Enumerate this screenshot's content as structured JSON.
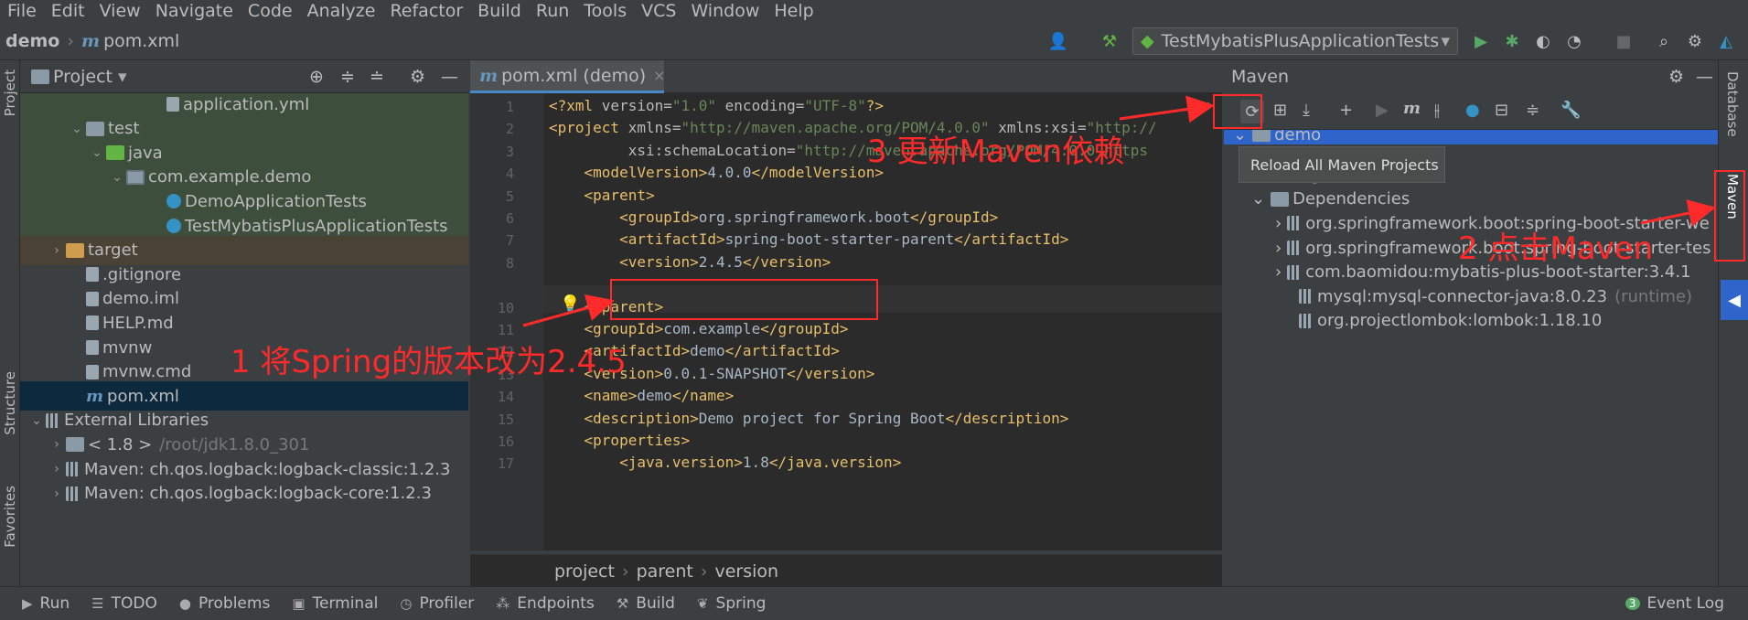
{
  "menu": [
    "File",
    "Edit",
    "View",
    "Navigate",
    "Code",
    "Analyze",
    "Refactor",
    "Build",
    "Run",
    "Tools",
    "VCS",
    "Window",
    "Help"
  ],
  "breadcrumb": {
    "project": "demo",
    "file": "pom.xml"
  },
  "run_config": "TestMybatisPlusApplicationTests",
  "left_strip": {
    "project": "Project",
    "structure": "Structure",
    "favorites": "Favorites"
  },
  "project_panel": {
    "title": "Project",
    "rows": [
      {
        "label": "application.yml",
        "indent": 140,
        "icon": "file",
        "arrow": ""
      },
      {
        "label": "test",
        "indent": 52,
        "icon": "folder",
        "arrow": "⌄"
      },
      {
        "label": "java",
        "indent": 74,
        "icon": "folderg",
        "arrow": "⌄"
      },
      {
        "label": "com.example.demo",
        "indent": 96,
        "icon": "pkg",
        "arrow": "⌄"
      },
      {
        "label": "DemoApplicationTests",
        "indent": 140,
        "icon": "cls",
        "arrow": ""
      },
      {
        "label": "TestMybatisPlusApplicationTests",
        "indent": 140,
        "icon": "cls",
        "arrow": ""
      },
      {
        "label": "target",
        "indent": 30,
        "icon": "foldero",
        "arrow": "›"
      },
      {
        "label": ".gitignore",
        "indent": 52,
        "icon": "file",
        "arrow": ""
      },
      {
        "label": "demo.iml",
        "indent": 52,
        "icon": "file",
        "arrow": ""
      },
      {
        "label": "HELP.md",
        "indent": 52,
        "icon": "file",
        "arrow": ""
      },
      {
        "label": "mvnw",
        "indent": 52,
        "icon": "file",
        "arrow": ""
      },
      {
        "label": "mvnw.cmd",
        "indent": 52,
        "icon": "file",
        "arrow": ""
      },
      {
        "label": "pom.xml",
        "indent": 52,
        "icon": "m",
        "arrow": ""
      },
      {
        "label": "External Libraries",
        "indent": 8,
        "icon": "lib",
        "arrow": "⌄"
      },
      {
        "label": "< 1.8 >",
        "extra": "/root/jdk1.8.0_301",
        "indent": 30,
        "icon": "folder",
        "arrow": "›"
      },
      {
        "label": "Maven: ch.qos.logback:logback-classic:1.2.3",
        "indent": 30,
        "icon": "lib",
        "arrow": "›"
      },
      {
        "label": "Maven: ch.qos.logback:logback-core:1.2.3",
        "indent": 30,
        "icon": "lib",
        "arrow": "›"
      }
    ]
  },
  "editor": {
    "tab": "pom.xml (demo)",
    "lines": [
      {
        "n": "1",
        "parts": [
          [
            "tg",
            "<?xml "
          ],
          [
            "at",
            "version="
          ],
          [
            "av",
            "\"1.0\""
          ],
          [
            "at",
            " encoding="
          ],
          [
            "av",
            "\"UTF-8\""
          ],
          [
            "tg",
            "?>"
          ]
        ]
      },
      {
        "n": "2",
        "parts": [
          [
            "tg",
            "<project "
          ],
          [
            "at",
            "xmlns="
          ],
          [
            "av",
            "\"http://maven.apache.org/POM/4.0.0\""
          ],
          [
            "at",
            " xmlns:xsi="
          ],
          [
            "av",
            "\"http://"
          ]
        ]
      },
      {
        "n": "3",
        "parts": [
          [
            "at",
            "         xsi:schemaLocation="
          ],
          [
            "av",
            "\"http://maven.apache.org/POM/4.0.0 https"
          ]
        ]
      },
      {
        "n": "4",
        "parts": [
          [
            "tg",
            "    <modelVersion>"
          ],
          [
            "tx",
            "4.0.0"
          ],
          [
            "tg",
            "</modelVersion>"
          ]
        ]
      },
      {
        "n": "5",
        "parts": [
          [
            "tg",
            "    <parent>"
          ]
        ]
      },
      {
        "n": "6",
        "parts": [
          [
            "tg",
            "        <groupId>"
          ],
          [
            "tx",
            "org.springframework.boot"
          ],
          [
            "tg",
            "</groupId>"
          ]
        ]
      },
      {
        "n": "7",
        "parts": [
          [
            "tg",
            "        <artifactId>"
          ],
          [
            "tx",
            "spring-boot-starter-parent"
          ],
          [
            "tg",
            "</artifactId>"
          ]
        ]
      },
      {
        "n": "8",
        "parts": [
          [
            "tg",
            "        <version>"
          ],
          [
            "tx",
            "2.4.5"
          ],
          [
            "tg",
            "</version>"
          ]
        ]
      },
      {
        "n": "",
        "parts": []
      },
      {
        "n": "10",
        "parts": [
          [
            "tg",
            "    </parent>"
          ]
        ]
      },
      {
        "n": "11",
        "parts": [
          [
            "tg",
            "    <groupId>"
          ],
          [
            "tx",
            "com.example"
          ],
          [
            "tg",
            "</groupId>"
          ]
        ]
      },
      {
        "n": "12",
        "parts": [
          [
            "tg",
            "    <artifactId>"
          ],
          [
            "tx",
            "demo"
          ],
          [
            "tg",
            "</artifactId>"
          ]
        ]
      },
      {
        "n": "13",
        "parts": [
          [
            "tg",
            "    <version>"
          ],
          [
            "tx",
            "0.0.1-SNAPSHOT"
          ],
          [
            "tg",
            "</version>"
          ]
        ]
      },
      {
        "n": "14",
        "parts": [
          [
            "tg",
            "    <name>"
          ],
          [
            "tx",
            "demo"
          ],
          [
            "tg",
            "</name>"
          ]
        ]
      },
      {
        "n": "15",
        "parts": [
          [
            "tg",
            "    <description>"
          ],
          [
            "tx",
            "Demo project for Spring Boot"
          ],
          [
            "tg",
            "</description>"
          ]
        ]
      },
      {
        "n": "16",
        "parts": [
          [
            "tg",
            "    <properties>"
          ]
        ]
      },
      {
        "n": "17",
        "parts": [
          [
            "tg",
            "        <java.version>"
          ],
          [
            "tx",
            "1.8"
          ],
          [
            "tg",
            "</java.version>"
          ]
        ]
      }
    ],
    "breadcrumb": [
      "project",
      "parent",
      "version"
    ]
  },
  "maven": {
    "title": "Maven",
    "tooltip": "Reload All Maven Projects",
    "rows": [
      {
        "label": "demo",
        "indent": 10,
        "arrow": "⌄",
        "selected": true
      },
      {
        "label": "Plugins",
        "indent": 30,
        "arrow": "›"
      },
      {
        "label": "Dependencies",
        "indent": 30,
        "arrow": "⌄"
      },
      {
        "label": "org.springframework.boot:spring-boot-starter-we",
        "indent": 56,
        "arrow": "›"
      },
      {
        "label": "org.springframework.boot:spring-boot-starter-tes",
        "indent": 56,
        "arrow": "›"
      },
      {
        "label": "com.baomidou:mybatis-plus-boot-starter:3.4.1",
        "indent": 56,
        "arrow": "›"
      },
      {
        "label": "mysql:mysql-connector-java:8.0.23",
        "extra": "(runtime)",
        "indent": 76,
        "arrow": ""
      },
      {
        "label": "org.projectlombok:lombok:1.18.10",
        "indent": 76,
        "arrow": ""
      }
    ]
  },
  "right_strip": {
    "database": "Database",
    "maven": "Maven"
  },
  "bottom_bar": [
    {
      "icon": "▶",
      "label": "Run"
    },
    {
      "icon": "☰",
      "label": "TODO"
    },
    {
      "icon": "●",
      "label": "Problems"
    },
    {
      "icon": "▣",
      "label": "Terminal"
    },
    {
      "icon": "◷",
      "label": "Profiler"
    },
    {
      "icon": "⁂",
      "label": "Endpoints"
    },
    {
      "icon": "⚒",
      "label": "Build"
    },
    {
      "icon": "❦",
      "label": "Spring"
    }
  ],
  "event_log": {
    "count": "3",
    "label": "Event Log"
  },
  "annotations": {
    "step1": "1 将Spring的版本改为2.4.5",
    "step2": "2 点击Maven",
    "step3": "3 更新Maven依赖"
  },
  "colors": {
    "annotation": "#ff2a2a",
    "selection": "#2f65ca",
    "accent": "#4a88c7"
  }
}
